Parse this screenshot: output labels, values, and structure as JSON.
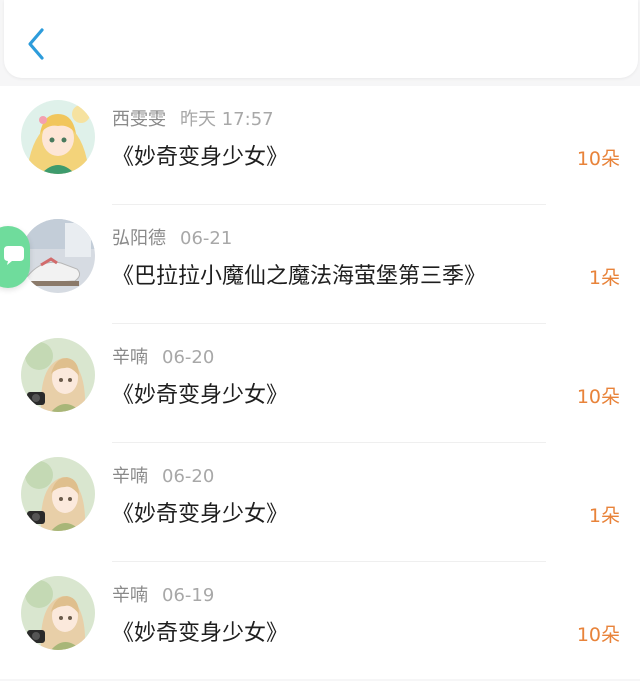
{
  "header": {
    "back_icon": "chevron-left-icon",
    "accent": "#2d9cdb"
  },
  "colors": {
    "count": "#e8833a",
    "float_badge": "#6fdc9c"
  },
  "float_badge_icon": "chat-bubble-icon",
  "records": [
    {
      "name": "西雯雯",
      "time": "昨天 17:57",
      "title": "《妙奇变身少女》",
      "count": "10朵",
      "avatar": "anime-girl-blonde-avatar"
    },
    {
      "name": "弘阳德",
      "time": "06-21",
      "title": "《巴拉拉小魔仙之魔法海萤堡第三季》",
      "count": "1朵",
      "avatar": "shoes-photo-avatar"
    },
    {
      "name": "辛喃",
      "time": "06-20",
      "title": "《妙奇变身少女》",
      "count": "10朵",
      "avatar": "anime-girl-camera-avatar"
    },
    {
      "name": "辛喃",
      "time": "06-20",
      "title": "《妙奇变身少女》",
      "count": "1朵",
      "avatar": "anime-girl-camera-avatar"
    },
    {
      "name": "辛喃",
      "time": "06-19",
      "title": "《妙奇变身少女》",
      "count": "10朵",
      "avatar": "anime-girl-camera-avatar"
    }
  ]
}
